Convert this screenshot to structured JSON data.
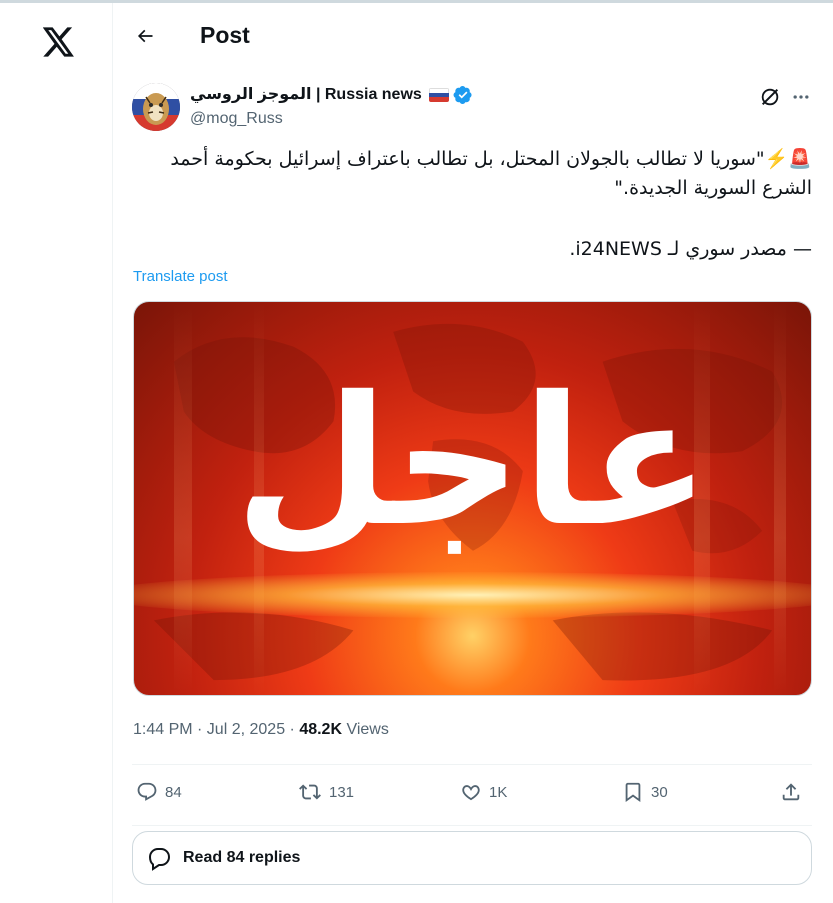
{
  "app": {
    "logo_icon": "x-logo-icon"
  },
  "header": {
    "title": "Post",
    "back_icon": "arrow-left-icon"
  },
  "author": {
    "display_name": "الموجز الروسي | Russia news",
    "flag": "russia-flag",
    "verified": true,
    "handle": "@mog_Russ"
  },
  "tweet": {
    "line1": "🚨⚡️\"سوريا لا تطالب بالجولان المحتل، بل تطالب باعتراف إسرائيل بحكومة أحمد الشرع السورية الجديدة.\"",
    "line2": "— مصدر سوري لـ i24NEWS.",
    "translate_label": "Translate post",
    "media_text": "عاجل"
  },
  "meta": {
    "time_date": "1:44 PM · Jul 2, 2025 · ",
    "views_count": "48.2K",
    "views_label": "Views"
  },
  "actions": {
    "replies": "84",
    "reposts": "131",
    "likes": "1K",
    "bookmarks": "30"
  },
  "read_replies_label": "Read 84 replies",
  "colors": {
    "accent": "#1d9bf0",
    "secondary_text": "#536471",
    "verified": "#1d9bf0"
  }
}
